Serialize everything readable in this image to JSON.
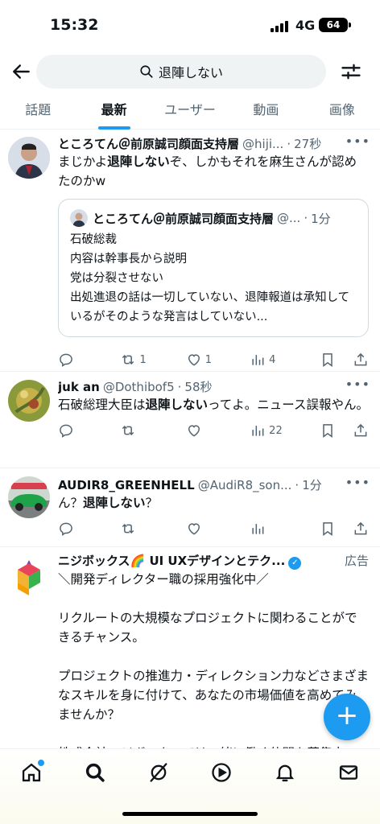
{
  "status": {
    "time": "15:32",
    "network": "4G",
    "battery": "64"
  },
  "search": {
    "query": "退陣しない"
  },
  "tabs": [
    {
      "label": "話題"
    },
    {
      "label": "最新",
      "active": true
    },
    {
      "label": "ユーザー"
    },
    {
      "label": "動画"
    },
    {
      "label": "画像"
    }
  ],
  "tweets": [
    {
      "name": "ところてん＠前原誠司顔面支持層",
      "handle": "@hiji...",
      "time": "27秒",
      "text_pre": "まじかよ",
      "text_bold": "退陣しない",
      "text_post": "ぞ、しかもそれを麻生さんが認めたのかw",
      "quote": {
        "name": "ところてん＠前原誠司顔面支持層",
        "handle": "@...",
        "time": "1分",
        "lines": [
          "石破総裁",
          "内容は幹事長から説明",
          "党は分裂させない",
          "出処進退の話は一切していない、退陣報道は承知しているがそのような発言はしていない..."
        ]
      },
      "stats": {
        "replies": "",
        "retweets": "1",
        "likes": "1",
        "views": "4"
      }
    },
    {
      "name": "juk an",
      "handle": "@Dothibof5",
      "time": "58秒",
      "text_pre": "石破総理大臣は",
      "text_bold": "退陣しない",
      "text_post": "ってよ。ニュース誤報やん。",
      "stats": {
        "replies": "",
        "retweets": "",
        "likes": "",
        "views": "22"
      }
    },
    {
      "name": "AUDIR8_GREENHELL",
      "handle": "@AudiR8_son...",
      "time": "1分",
      "text_pre": "ん？",
      "text_bold": "退陣しない",
      "text_post": "？",
      "stats": {
        "replies": "",
        "retweets": "",
        "likes": "",
        "views": ""
      }
    },
    {
      "name": "ニジボックス🌈 UI UXデザインとテク...",
      "ad_label": "広告",
      "text": "＼開発ディレクター職の採用強化中／\n\nリクルートの大規模なプロジェクトに関わることができるチャンス。\n\nプロジェクトの推進力・ディレクション力などさまざまなスキルを身に付けて、あなたの市場価値を高めてみませんか？\n\n株式会社ニジボックスでは一緒に働く仲間を募集中"
    }
  ],
  "colors": {
    "accent": "#1d9bf0",
    "text": "#0f1419",
    "muted": "#536471"
  }
}
